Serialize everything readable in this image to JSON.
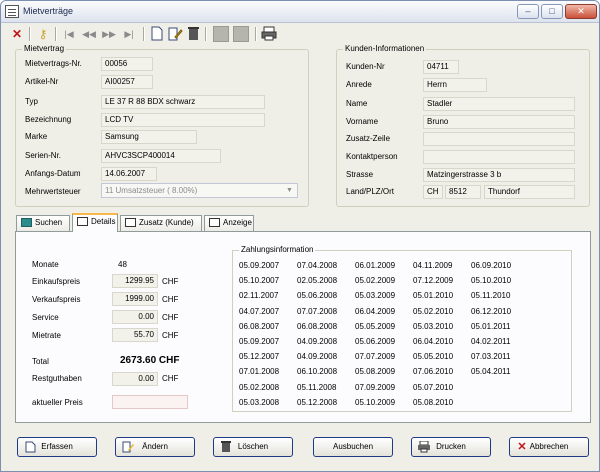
{
  "window": {
    "title": "Mietverträge",
    "minimize": "–",
    "maximize": "□",
    "close": "✕"
  },
  "toolbar": {
    "icons": [
      "close-red-icon",
      "key-icon",
      "first-icon",
      "prev-icon",
      "next-icon",
      "last-icon",
      "new-doc-icon",
      "edit-doc-icon",
      "delete-icon",
      "blank-1-icon",
      "blank-2-icon",
      "print-icon"
    ]
  },
  "mietvertrag": {
    "title": "Mietvertrag",
    "vertrag_nr_label": "Mietvertrags-Nr.",
    "vertrag_nr": "00056",
    "artikel_nr_label": "Artikel-Nr",
    "artikel_nr": "AI00257",
    "typ_label": "Typ",
    "typ": "LE 37 R 88 BDX schwarz",
    "bezeichnung_label": "Bezeichnung",
    "bezeichnung": "LCD TV",
    "marke_label": "Marke",
    "marke": "Samsung",
    "serien_label": "Serien-Nr.",
    "serien": "AHVC3SCP400014",
    "anfang_label": "Anfangs-Datum",
    "anfang": "14.06.2007",
    "mwst_label": "Mehrwertsteuer",
    "mwst": "11  Umsatzsteuer  ( 8.00%)"
  },
  "kunde": {
    "title": "Kunden-Informationen",
    "nr_label": "Kunden-Nr",
    "nr": "04711",
    "anrede_label": "Anrede",
    "anrede": "Herrn",
    "name_label": "Name",
    "name": "Stadler",
    "vorname_label": "Vorname",
    "vorname": "Bruno",
    "zusatz_label": "Zusatz-Zeile",
    "zusatz": "",
    "kontakt_label": "Kontaktperson",
    "kontakt": "",
    "strasse_label": "Strasse",
    "strasse": "Matzingerstrasse 3 b",
    "ort_label": "Land/PLZ/Ort",
    "land": "CH",
    "plz": "8512",
    "ort": "Thundorf"
  },
  "tabs": [
    {
      "label": "Suchen",
      "active": false
    },
    {
      "label": "Details",
      "active": true
    },
    {
      "label": "Zusatz (Kunde)",
      "active": false
    },
    {
      "label": "Anzeige",
      "active": false
    }
  ],
  "details": {
    "monate_label": "Monate",
    "monate": "48",
    "einkauf_label": "Einkaufspreis",
    "einkauf": "1299.95",
    "einkauf_cur": "CHF",
    "verkauf_label": "Verkaufspreis",
    "verkauf": "1999.00",
    "verkauf_cur": "CHF",
    "service_label": "Service",
    "service": "0.00",
    "service_cur": "CHF",
    "mietrate_label": "Mietrate",
    "mietrate": "55.70",
    "mietrate_cur": "CHF",
    "total_label": "Total",
    "total": "2673.60  CHF",
    "rest_label": "Restguthaben",
    "rest": "0.00",
    "rest_cur": "CHF",
    "aktuell_label": "aktueller Preis",
    "aktuell": ""
  },
  "zahlung": {
    "title": "Zahlungsinformation",
    "columns": [
      [
        "05.09.2007",
        "05.10.2007",
        "02.11.2007",
        "04.07.2007",
        "06.08.2007",
        "05.09.2007",
        "05.12.2007",
        "07.01.2008",
        "05.02.2008",
        "05.03.2008"
      ],
      [
        "07.04.2008",
        "02.05.2008",
        "05.06.2008",
        "07.07.2008",
        "06.08.2008",
        "04.09.2008",
        "04.09.2008",
        "06.10.2008",
        "05.11.2008",
        "05.12.2008"
      ],
      [
        "06.01.2009",
        "05.02.2009",
        "05.03.2009",
        "06.04.2009",
        "05.05.2009",
        "05.06.2009",
        "07.07.2009",
        "05.08.2009",
        "07.09.2009",
        "05.10.2009"
      ],
      [
        "04.11.2009",
        "07.12.2009",
        "05.01.2010",
        "05.02.2010",
        "05.03.2010",
        "06.04.2010",
        "05.05.2010",
        "07.06.2010",
        "05.07.2010",
        "05.08.2010"
      ],
      [
        "06.09.2010",
        "05.10.2010",
        "05.11.2010",
        "06.12.2010",
        "05.01.2011",
        "04.02.2011",
        "07.03.2011",
        "05.04.2011"
      ]
    ]
  },
  "buttons": {
    "erfassen": "Erfassen",
    "aendern": "Ändern",
    "loeschen": "Löschen",
    "ausbuchen": "Ausbuchen",
    "drucken": "Drucken",
    "abbrechen": "Abbrechen"
  }
}
